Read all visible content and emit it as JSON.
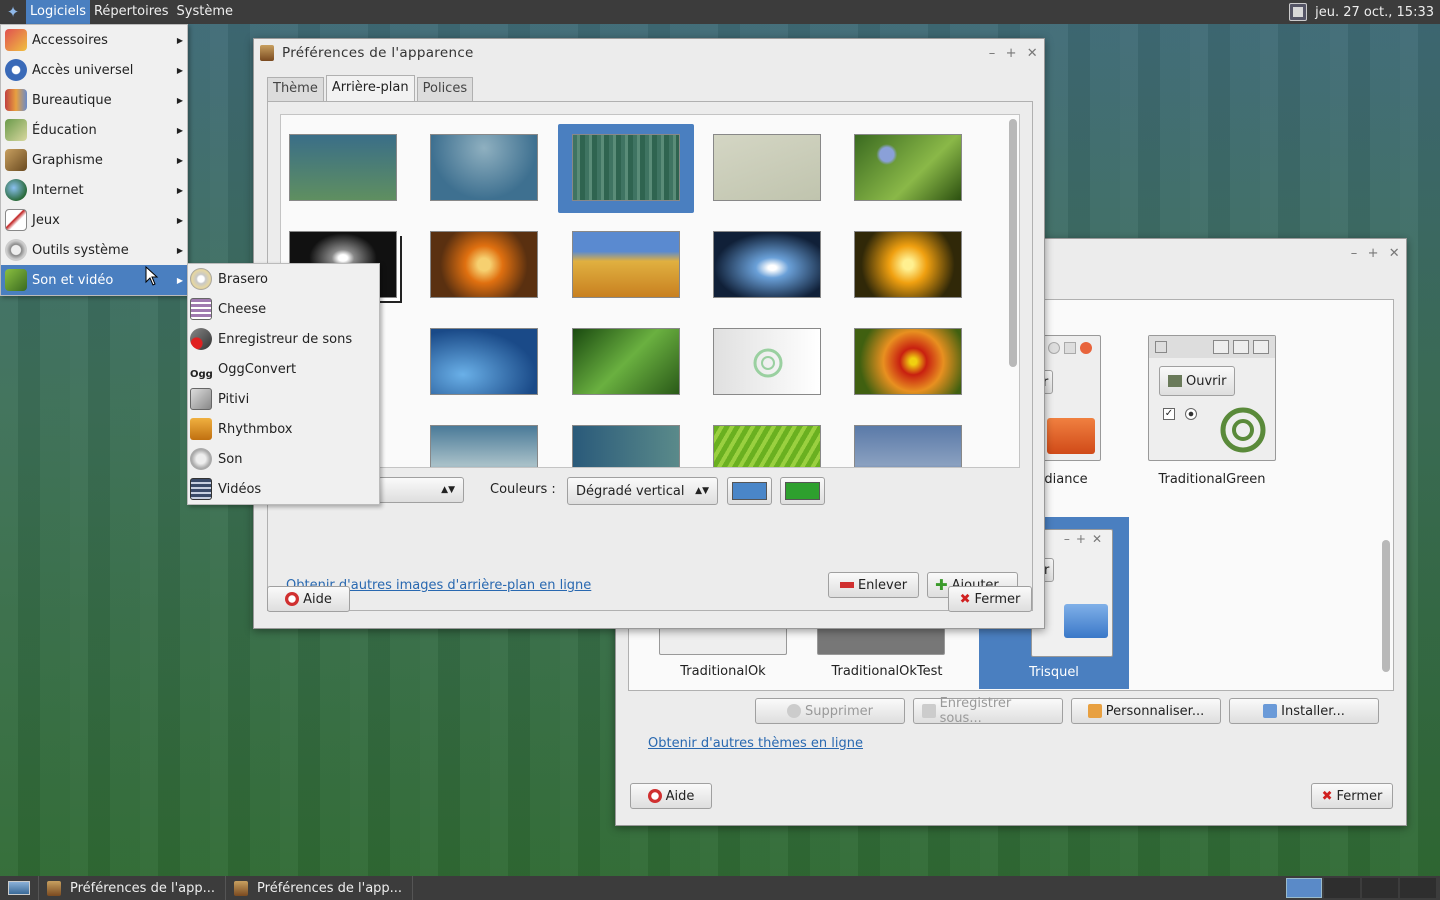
{
  "top_panel": {
    "menus": [
      "Logiciels",
      "Répertoires",
      "Système"
    ],
    "clock": "jeu. 27 oct., 15:33"
  },
  "app_menu": {
    "items": [
      {
        "label": "Accessoires",
        "icon": "accessories-icon"
      },
      {
        "label": "Accès universel",
        "icon": "accessibility-icon"
      },
      {
        "label": "Bureautique",
        "icon": "office-icon"
      },
      {
        "label": "Éducation",
        "icon": "education-icon"
      },
      {
        "label": "Graphisme",
        "icon": "graphics-icon"
      },
      {
        "label": "Internet",
        "icon": "internet-icon"
      },
      {
        "label": "Jeux",
        "icon": "games-icon"
      },
      {
        "label": "Outils système",
        "icon": "system-tools-icon"
      },
      {
        "label": "Son et vidéo",
        "icon": "multimedia-icon"
      }
    ],
    "submenu": [
      {
        "label": "Brasero",
        "icon": "brasero-icon"
      },
      {
        "label": "Cheese",
        "icon": "cheese-icon"
      },
      {
        "label": "Enregistreur de sons",
        "icon": "sound-recorder-icon"
      },
      {
        "label": "OggConvert",
        "icon": "oggconvert-icon"
      },
      {
        "label": "Pitivi",
        "icon": "pitivi-icon"
      },
      {
        "label": "Rhythmbox",
        "icon": "rhythmbox-icon"
      },
      {
        "label": "Son",
        "icon": "sound-icon"
      },
      {
        "label": "Vidéos",
        "icon": "videos-icon"
      }
    ]
  },
  "main_window": {
    "title": "Préférences de l'apparence",
    "tabs": [
      "Thème",
      "Arrière-plan",
      "Polices"
    ],
    "colors_label": "Couleurs :",
    "gradient_select": "Dégradé vertical",
    "color1": "#4a86c8",
    "color2": "#2ea02e",
    "link": "Obtenir d'autres images d'arrière-plan en ligne",
    "remove": "Enlever",
    "add": "Ajouter...",
    "help": "Aide",
    "close": "Fermer"
  },
  "back_window": {
    "themes": [
      "TraditionalOk",
      "TraditionalOkTest",
      "Trisquel"
    ],
    "theme_partial": "diance",
    "theme_right": "TraditionalGreen",
    "preview_open": "Ouvrir",
    "preview_open_partial": "rir",
    "delete": "Supprimer",
    "save_as": "Enregistrer sous...",
    "customize": "Personnaliser...",
    "install": "Installer...",
    "link": "Obtenir d'autres thèmes en ligne",
    "help": "Aide",
    "close": "Fermer"
  },
  "taskbar": {
    "tasks": [
      "Préférences de l'app...",
      "Préférences de l'app..."
    ]
  }
}
